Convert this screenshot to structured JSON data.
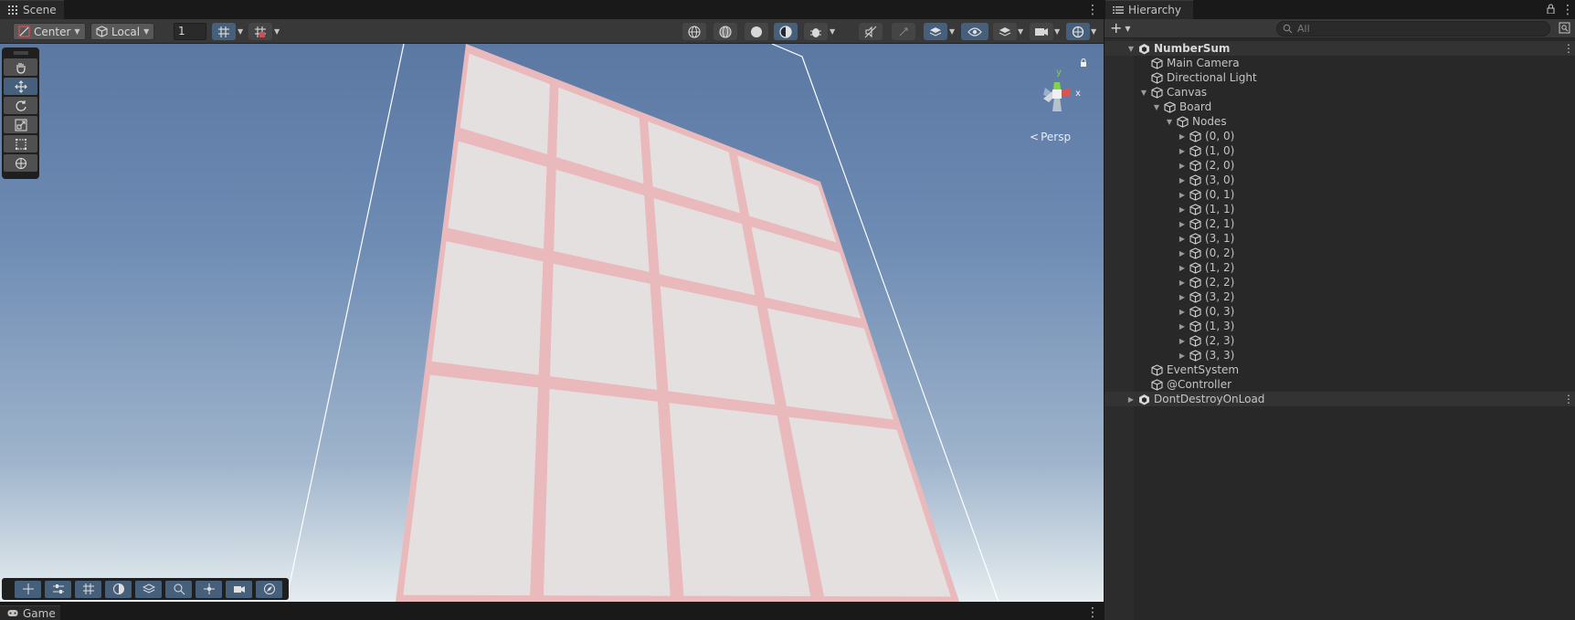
{
  "scene_panel": {
    "tab_label": "Scene",
    "toolbar": {
      "pivot_mode": "Center",
      "pivot_rotation": "Local",
      "snap_increment": "1"
    },
    "view": {
      "camera_mode": "Persp",
      "gizmo_axes": {
        "x": "x",
        "y": "y"
      }
    },
    "tools": [
      "hand-tool",
      "move-tool",
      "rotate-tool",
      "scale-tool",
      "rect-tool",
      "transform-tool"
    ]
  },
  "game_panel": {
    "tab_label": "Game"
  },
  "hierarchy_panel": {
    "tab_label": "Hierarchy",
    "search_placeholder": "All",
    "rows": [
      {
        "label": "NumberSum",
        "depth": 0,
        "expander": "open",
        "type": "scene"
      },
      {
        "label": "Main Camera",
        "depth": 1,
        "expander": "none",
        "type": "object"
      },
      {
        "label": "Directional Light",
        "depth": 1,
        "expander": "none",
        "type": "object"
      },
      {
        "label": "Canvas",
        "depth": 1,
        "expander": "open",
        "type": "object"
      },
      {
        "label": "Board",
        "depth": 2,
        "expander": "open",
        "type": "object"
      },
      {
        "label": "Nodes",
        "depth": 3,
        "expander": "open",
        "type": "object"
      },
      {
        "label": "(0, 0)",
        "depth": 4,
        "expander": "closed",
        "type": "object"
      },
      {
        "label": "(1, 0)",
        "depth": 4,
        "expander": "closed",
        "type": "object"
      },
      {
        "label": "(2, 0)",
        "depth": 4,
        "expander": "closed",
        "type": "object"
      },
      {
        "label": "(3, 0)",
        "depth": 4,
        "expander": "closed",
        "type": "object"
      },
      {
        "label": "(0, 1)",
        "depth": 4,
        "expander": "closed",
        "type": "object"
      },
      {
        "label": "(1, 1)",
        "depth": 4,
        "expander": "closed",
        "type": "object"
      },
      {
        "label": "(2, 1)",
        "depth": 4,
        "expander": "closed",
        "type": "object"
      },
      {
        "label": "(3, 1)",
        "depth": 4,
        "expander": "closed",
        "type": "object"
      },
      {
        "label": "(0, 2)",
        "depth": 4,
        "expander": "closed",
        "type": "object"
      },
      {
        "label": "(1, 2)",
        "depth": 4,
        "expander": "closed",
        "type": "object"
      },
      {
        "label": "(2, 2)",
        "depth": 4,
        "expander": "closed",
        "type": "object"
      },
      {
        "label": "(3, 2)",
        "depth": 4,
        "expander": "closed",
        "type": "object"
      },
      {
        "label": "(0, 3)",
        "depth": 4,
        "expander": "closed",
        "type": "object"
      },
      {
        "label": "(1, 3)",
        "depth": 4,
        "expander": "closed",
        "type": "object"
      },
      {
        "label": "(2, 3)",
        "depth": 4,
        "expander": "closed",
        "type": "object"
      },
      {
        "label": "(3, 3)",
        "depth": 4,
        "expander": "closed",
        "type": "object"
      },
      {
        "label": "EventSystem",
        "depth": 1,
        "expander": "none",
        "type": "object"
      },
      {
        "label": "@Controller",
        "depth": 1,
        "expander": "none",
        "type": "object"
      },
      {
        "label": "DontDestroyOnLoad",
        "depth": 0,
        "expander": "closed",
        "type": "scene"
      }
    ]
  },
  "colors": {
    "accent_blue": "#46607c",
    "panel_bg": "#282828",
    "board_fill": "#e4e0e0",
    "board_grid": "#e9b9bb"
  }
}
